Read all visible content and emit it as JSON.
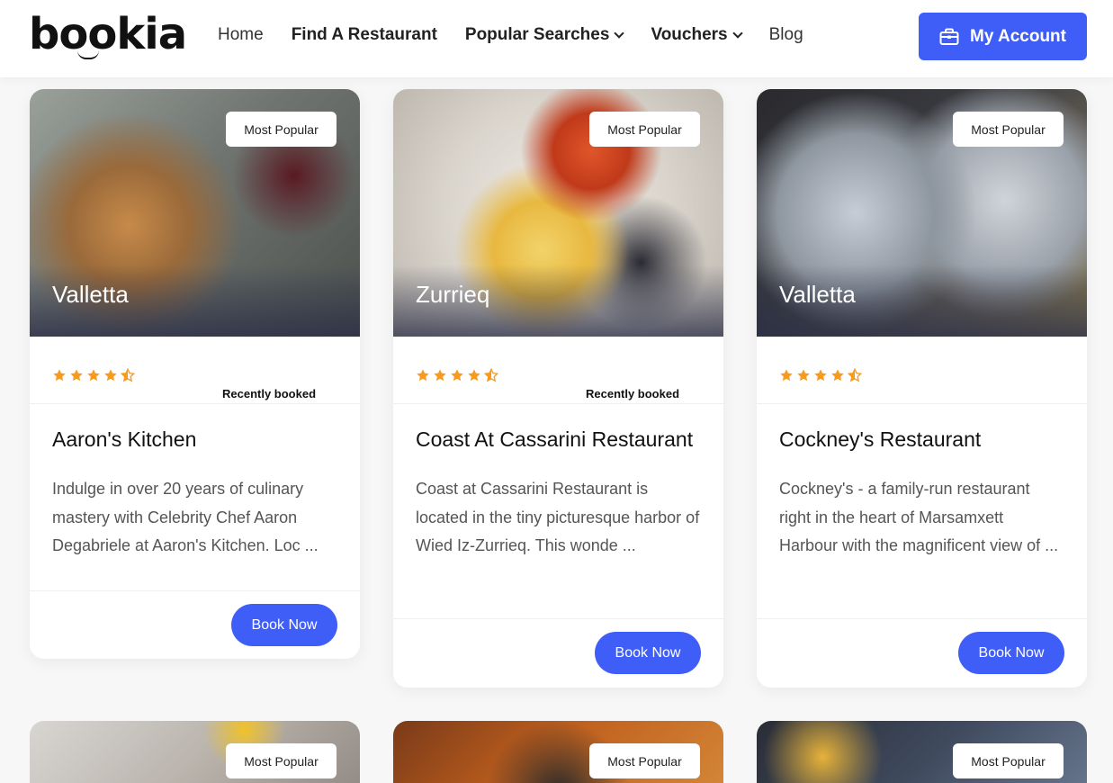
{
  "header": {
    "logo": "bookia",
    "nav": [
      {
        "label": "Home"
      },
      {
        "label": "Find A Restaurant"
      },
      {
        "label": "Popular Searches"
      },
      {
        "label": "Vouchers"
      },
      {
        "label": "Blog"
      }
    ],
    "account_label": "My Account"
  },
  "colors": {
    "accent": "#3f5ef8",
    "star": "#f79a1e"
  },
  "cards": [
    {
      "badge": "Most Popular",
      "city": "Valletta",
      "rating": 4.5,
      "recently_booked": "Recently booked",
      "title": "Aaron's Kitchen",
      "description": "Indulge in over 20 years of culinary mastery with Celebrity Chef Aaron Degabriele at Aaron's Kitchen. Loc ...",
      "button": "Book Now"
    },
    {
      "badge": "Most Popular",
      "city": "Zurrieq",
      "rating": 4.5,
      "recently_booked": "Recently booked",
      "title": "Coast At Cassarini Restaurant",
      "description": "Coast at Cassarini Restaurant is located in the tiny picturesque harbor of Wied Iz-Zurrieq. This wonde ...",
      "button": "Book Now"
    },
    {
      "badge": "Most Popular",
      "city": "Valletta",
      "rating": 4.5,
      "recently_booked": "",
      "title": "Cockney's Restaurant",
      "description": "Cockney's - a family-run restaurant right in the heart of Marsamxett Harbour with the magnificent view of ...",
      "button": "Book Now"
    }
  ],
  "next_row_badges": [
    "Most Popular",
    "Most Popular",
    "Most Popular"
  ]
}
